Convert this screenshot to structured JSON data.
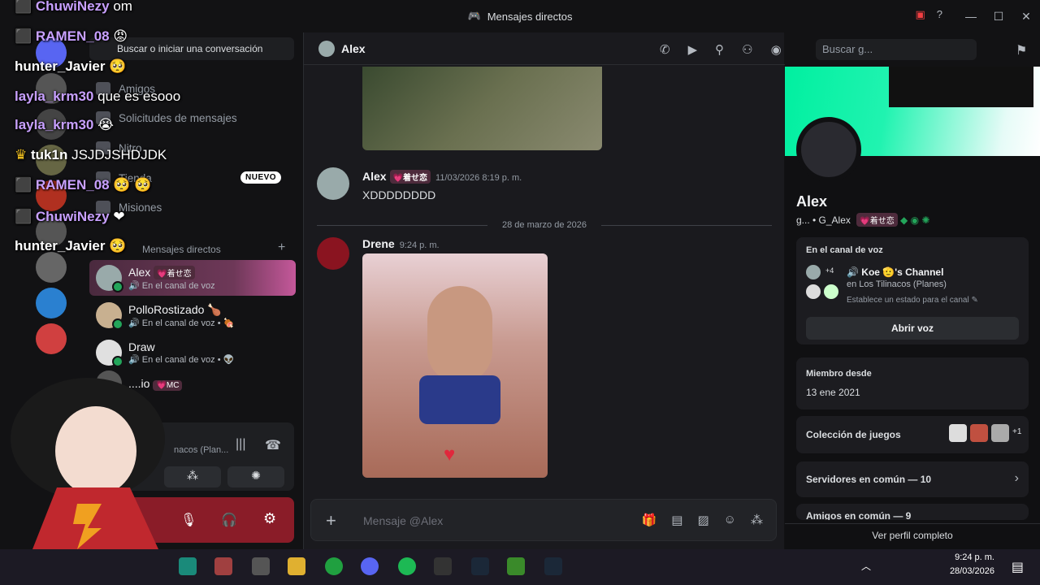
{
  "window": {
    "title": "Mensajes directos"
  },
  "dm_sidebar": {
    "search_label": "Buscar o iniciar una conversación",
    "nav": [
      {
        "label": "Amigos",
        "icon": "friends-icon"
      },
      {
        "label": "Solicitudes de mensajes",
        "icon": "mail-icon"
      },
      {
        "label": "Nitro",
        "icon": "nitro-icon"
      },
      {
        "label": "Tienda",
        "icon": "shop-icon"
      },
      {
        "label": "Misiones",
        "icon": "quests-icon"
      }
    ],
    "new_badge": "NUEVO",
    "dm_header": "Mensajes directos",
    "dms": [
      {
        "name": "Alex",
        "tag": "💗着せ恋",
        "status": "En el canal de voz"
      },
      {
        "name": "PolloRostizado 🍗",
        "tag": "",
        "status": "En el canal de voz • 🍖"
      },
      {
        "name": "Draw",
        "tag": "",
        "status": "En el canal de voz • 👽"
      },
      {
        "name": "....io",
        "tag": "💗MC",
        "status": ""
      }
    ],
    "voice_channel_text": "nacos (Plan..."
  },
  "chat": {
    "recipient": "Alex",
    "search_placeholder": "Buscar g...",
    "messages": [
      {
        "author": "Alex",
        "tag": "💗着せ恋",
        "time": "11/03/2026 8:19 p. m.",
        "text": "XDDDDDDDD"
      },
      {
        "author": "Drene",
        "tag": "",
        "time": "9:24 p. m.",
        "text": ""
      }
    ],
    "date_divider": "28 de marzo de 2026",
    "composer_placeholder": "Mensaje @Alex"
  },
  "profile": {
    "name": "Alex",
    "username": "g... • G_Alex",
    "tag": "💗着せ恋",
    "voice_card": {
      "title": "En el canal de voz",
      "channel": "🔊 Koe 🫡's Channel",
      "server": "en Los Tilinacos (Planes)",
      "extra_count": "+4",
      "status_hint": "Establece un estado para el canal ✎",
      "join_button": "Abrir voz"
    },
    "member_since": {
      "title": "Miembro desde",
      "date": "13 ene 2021"
    },
    "games": {
      "title": "Colección de juegos",
      "extra": "+1"
    },
    "servers": "Servidores en común — 10",
    "friends": "Amigos en común — 9",
    "full_profile": "Ver perfil completo"
  },
  "stream_chat": [
    {
      "user": "ChuwiNezy",
      "msg": "om",
      "color": "#c8a0ff"
    },
    {
      "user": "RAMEN_08",
      "msg": "😡",
      "color": "#c8a0ff"
    },
    {
      "user": "hunter_Javier",
      "msg": "🥺",
      "color": "#ffffff"
    },
    {
      "user": "layla_krm30",
      "msg": "que es esooo",
      "color": "#c8a0ff"
    },
    {
      "user": "layla_krm30",
      "msg": "😭",
      "color": "#c8a0ff"
    },
    {
      "user": "tuk1n",
      "msg": "JSJDJSHDJDK",
      "color": "#ffffff"
    },
    {
      "user": "RAMEN_08",
      "msg": "🥺 🥺",
      "color": "#c8a0ff"
    },
    {
      "user": "ChuwiNezy",
      "msg": "❤",
      "color": "#c8a0ff"
    },
    {
      "user": "hunter_Javier",
      "msg": "🥺",
      "color": "#ffffff"
    }
  ],
  "taskbar": {
    "time": "9:24 p. m.",
    "date": "28/03/2026"
  }
}
